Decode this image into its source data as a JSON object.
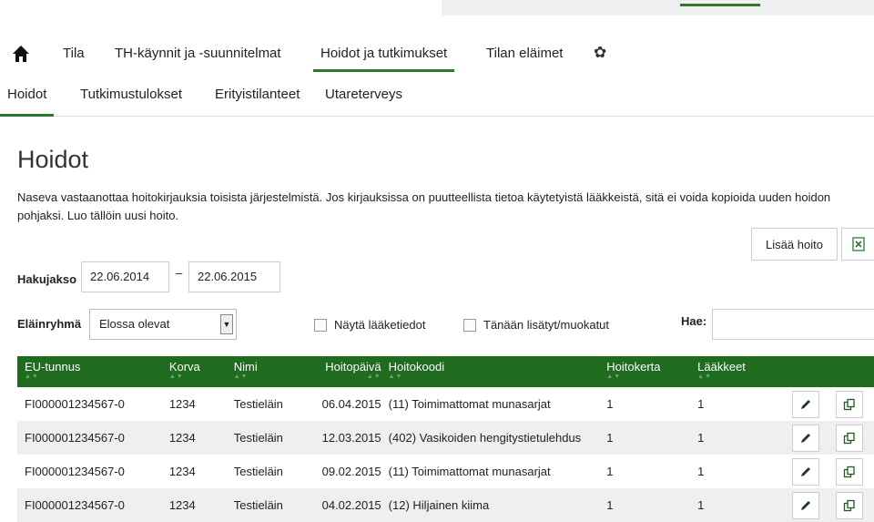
{
  "mainnav": {
    "items": [
      {
        "label": "Tila"
      },
      {
        "label": "TH-käynnit ja -suunnitelmat"
      },
      {
        "label": "Hoidot ja tutkimukset"
      },
      {
        "label": "Tilan eläimet"
      }
    ]
  },
  "subnav": {
    "items": [
      {
        "label": "Hoidot"
      },
      {
        "label": "Tutkimustulokset"
      },
      {
        "label": "Erityistilanteet"
      },
      {
        "label": "Utareterveys"
      }
    ]
  },
  "page": {
    "title": "Hoidot",
    "info": "Naseva vastaanottaa hoitokirjauksia toisista järjestelmistä. Jos kirjauksissa on puutteellista tietoa käytetyistä lääkkeistä, sitä ei voida kopioida uuden hoidon pohjaksi. Luo tällöin uusi hoito."
  },
  "toolbar": {
    "add_label": "Lisää hoito"
  },
  "filters": {
    "period_label": "Hakujakso",
    "start": "22.06.2014",
    "dash": "–",
    "end": "22.06.2015",
    "group_label": "Eläinryhmä",
    "group_value": "Elossa olevat",
    "show_meds": "Näytä lääketiedot",
    "today_changes": "Tänään lisätyt/muokatut",
    "search_label": "Hae:"
  },
  "table": {
    "headers": [
      "EU-tunnus",
      "Korva",
      "Nimi",
      "Hoitopäivä",
      "Hoitokoodi",
      "Hoitokerta",
      "Lääkkeet"
    ],
    "rows": [
      {
        "eu": "FI000001234567-0",
        "korva": "1234",
        "nimi": "Testieläin",
        "pvm": "06.04.2015",
        "koodi": "(11) Toimimattomat munasarjat",
        "kerta": "1",
        "laakkeet": "1"
      },
      {
        "eu": "FI000001234567-0",
        "korva": "1234",
        "nimi": "Testieläin",
        "pvm": "12.03.2015",
        "koodi": "(402) Vasikoiden hengitystietulehdus",
        "kerta": "1",
        "laakkeet": "1"
      },
      {
        "eu": "FI000001234567-0",
        "korva": "1234",
        "nimi": "Testieläin",
        "pvm": "09.02.2015",
        "koodi": "(11) Toimimattomat munasarjat",
        "kerta": "1",
        "laakkeet": "1"
      },
      {
        "eu": "FI000001234567-0",
        "korva": "1234",
        "nimi": "Testieläin",
        "pvm": "04.02.2015",
        "koodi": "(12) Hiljainen kiima",
        "kerta": "1",
        "laakkeet": "1"
      }
    ]
  },
  "colors": {
    "accent": "#2d7a2d",
    "header_bg": "#1f6b1f"
  },
  "icons": [
    "home-icon",
    "gear-icon",
    "excel-icon",
    "edit-icon",
    "copy-icon",
    "dropdown-arrow-icon",
    "sort-icon"
  ]
}
